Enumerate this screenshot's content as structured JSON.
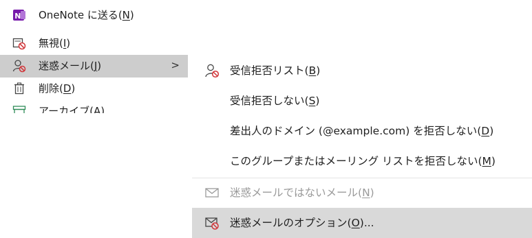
{
  "main_menu": {
    "items": [
      {
        "label": "OneNote に送る(",
        "key": "N",
        "suffix": ")",
        "icon": "onenote-icon"
      },
      {
        "label": "無視(",
        "key": "I",
        "suffix": ")",
        "icon": "ignore-icon"
      },
      {
        "label": "迷惑メール(",
        "key": "J",
        "suffix": ")",
        "icon": "junk-user-icon",
        "submenu_arrow": ">"
      },
      {
        "label": "削除(",
        "key": "D",
        "suffix": ")",
        "icon": "trash-icon"
      },
      {
        "label": "アーカイブ(A)",
        "icon": "archive-icon"
      }
    ]
  },
  "submenu": {
    "items": [
      {
        "label": "受信拒否リスト(",
        "key": "B",
        "suffix": ")",
        "icon": "block-sender-icon"
      },
      {
        "label": "受信拒否しない(",
        "key": "S",
        "suffix": ")"
      },
      {
        "label": "差出人のドメイン (@example.com) を拒否しない(",
        "key": "D",
        "suffix": ")"
      },
      {
        "label": "このグループまたはメーリング リストを拒否しない(",
        "key": "M",
        "suffix": ")"
      },
      {
        "label": "迷惑メールではないメール(",
        "key": "N",
        "suffix": ")",
        "icon": "envelope-icon",
        "disabled": true
      },
      {
        "label": "迷惑メールのオプション(",
        "key": "O",
        "suffix": ")...",
        "icon": "junk-options-icon"
      }
    ]
  },
  "colors": {
    "onenote_purple": "#7719aa",
    "block_red": "#d13438",
    "hover_gray": "#cdcdcd",
    "disabled_text": "#9a9a9a"
  }
}
